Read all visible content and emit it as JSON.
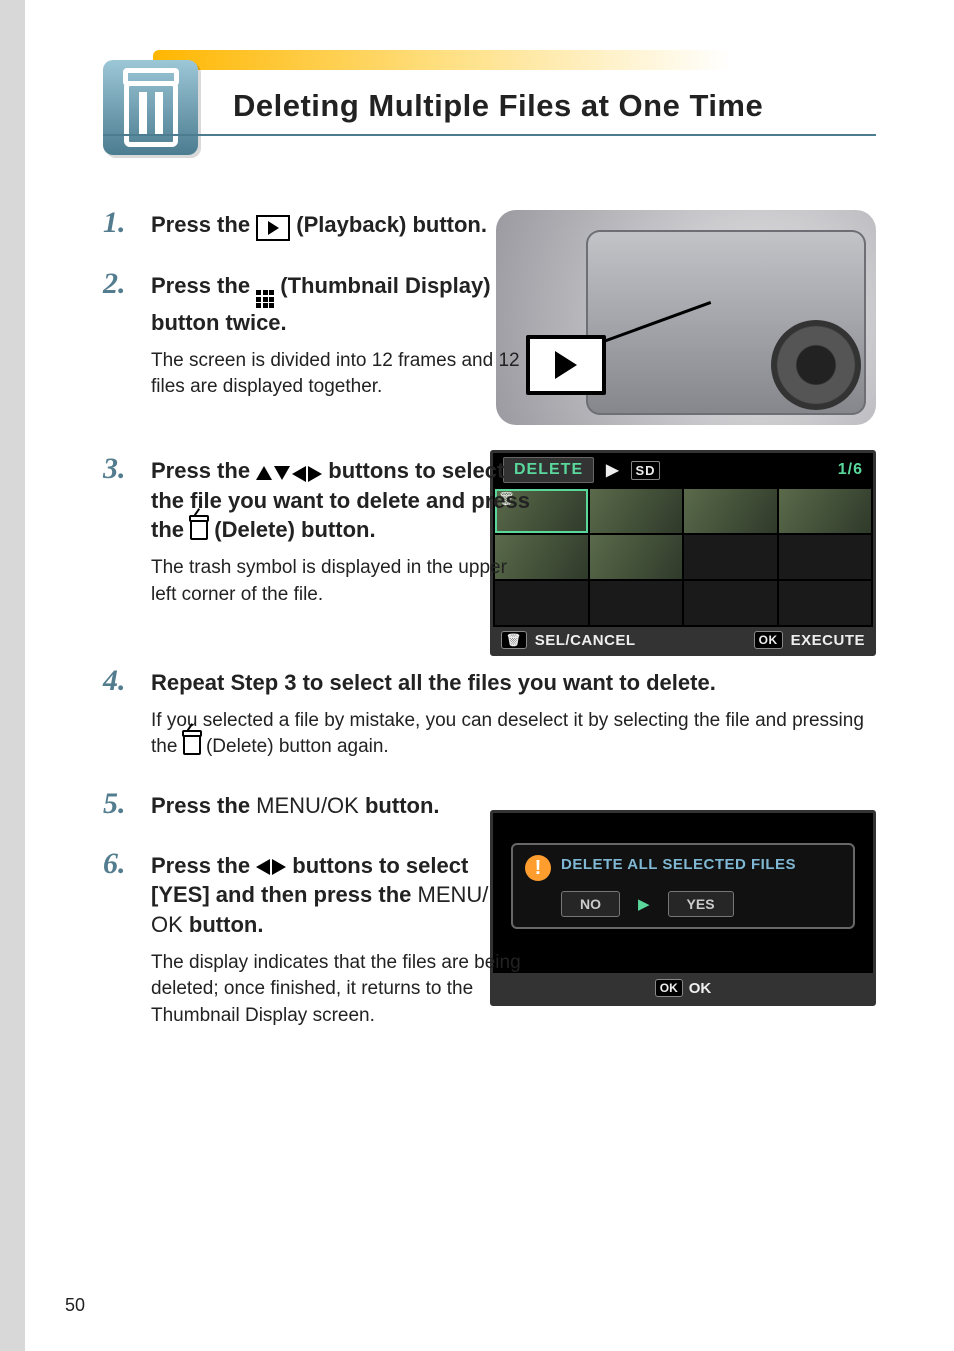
{
  "page_number": "50",
  "header": {
    "title": "Deleting Multiple Files at One Time",
    "icon": "trash-icon"
  },
  "steps": [
    {
      "head_parts": [
        "Press the ",
        " (Playback) button."
      ],
      "body": ""
    },
    {
      "head_parts": [
        "Press the ",
        " (Thumbnail Display) button twice."
      ],
      "body": "The screen is divided into 12 frames and 12 files are displayed together."
    },
    {
      "head_parts": [
        "Press the ",
        " buttons to select the file you want to delete and press the ",
        " (Delete) button."
      ],
      "body": "The trash symbol is displayed in the upper left corner of the file."
    },
    {
      "head_parts": [
        "Repeat Step 3 to select all the files you want to delete."
      ],
      "body_parts": [
        "If you selected a file by mistake, you can deselect it by selecting the file and pressing the ",
        " (Delete) button again."
      ]
    },
    {
      "head_parts": [
        "Press the ",
        " button."
      ],
      "body": ""
    },
    {
      "head_parts": [
        "Press the ",
        " buttons to select [YES] and then press the ",
        " button."
      ],
      "body": "The display indicates that the files are being deleted; once finished, it returns to the Thumbnail Display screen."
    }
  ],
  "glyphs": {
    "menuok": "MENU/OK",
    "menu_slash": "MENU/",
    "ok_alone": "OK"
  },
  "fig_screen1": {
    "title": "DELETE",
    "counter": "1/6",
    "bottom_left_btn": "🗑",
    "bottom_left": "SEL/CANCEL",
    "bottom_right_btn": "OK",
    "bottom_right": "EXECUTE"
  },
  "fig_screen2": {
    "dialog_msg": "DELETE ALL SELECTED FILES",
    "opt_no": "NO",
    "opt_yes": "YES",
    "bottom_btn": "OK",
    "bottom_label": "OK"
  }
}
